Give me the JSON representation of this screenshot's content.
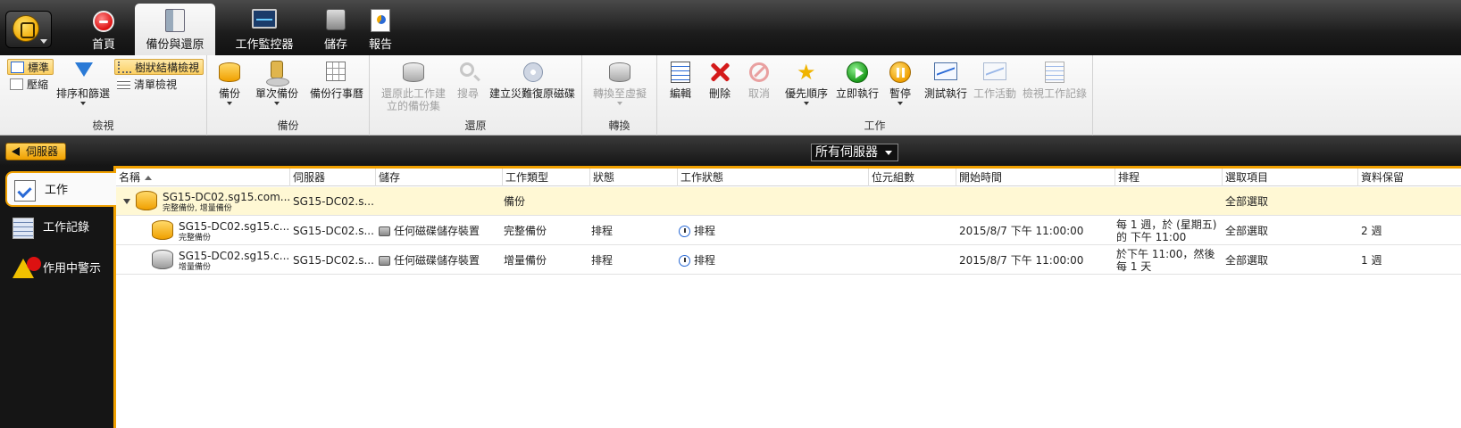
{
  "tabs": [
    {
      "label": "首頁",
      "icon": "home-icon"
    },
    {
      "label": "備份與還原",
      "icon": "backup-restore-icon",
      "active": true
    },
    {
      "label": "工作監控器",
      "icon": "monitor-icon"
    },
    {
      "label": "儲存",
      "icon": "storage-icon"
    },
    {
      "label": "報告",
      "icon": "report-icon"
    }
  ],
  "ribbon": {
    "view": {
      "label": "檢視",
      "standard": "標準",
      "compact": "壓縮",
      "sort_filter": "排序和篩選",
      "tree_view": "樹狀結構檢視",
      "list_view": "清單檢視"
    },
    "backup": {
      "label": "備份",
      "backup": "備份",
      "one_time": "單次備份",
      "calendar": "備份行事曆"
    },
    "restore": {
      "label": "還原",
      "restore_from_set": "還原此工作建立的備份集",
      "search": "搜尋",
      "create_dr_disk": "建立災難復原磁碟"
    },
    "convert": {
      "label": "轉換",
      "convert_to_virtual": "轉換至虛擬"
    },
    "jobs": {
      "label": "工作",
      "edit": "編輯",
      "delete": "刪除",
      "cancel": "取消",
      "priority": "優先順序",
      "run_now": "立即執行",
      "pause": "暫停",
      "test_run": "測試執行",
      "job_activity": "工作活動",
      "view_history": "檢視工作記錄"
    }
  },
  "navbar": {
    "back_label": "伺服器",
    "server_filter": "所有伺服器"
  },
  "leftnav": [
    {
      "label": "工作",
      "icon": "job-icon",
      "active": true
    },
    {
      "label": "工作記錄",
      "icon": "job-history-icon"
    },
    {
      "label": "作用中警示",
      "icon": "active-alerts-icon"
    }
  ],
  "columns": [
    "名稱",
    "伺服器",
    "儲存",
    "工作類型",
    "狀態",
    "工作狀態",
    "位元組數",
    "開始時間",
    "排程",
    "選取項目",
    "資料保留"
  ],
  "rows": [
    {
      "name": "SG15-DC02.sg15.com...",
      "subname": "完整備份, 增量備份",
      "server": "SG15-DC02.s...",
      "storage": "",
      "job_type": "備份",
      "status": "",
      "job_status": "",
      "bytes": "",
      "start_time": "",
      "schedule": "",
      "selection": "全部選取",
      "retention": ""
    },
    {
      "name": "SG15-DC02.sg15.c...",
      "subname": "完整備份",
      "server": "SG15-DC02.s...",
      "storage": "任何磁碟儲存裝置",
      "job_type": "完整備份",
      "status": "排程",
      "job_status": "排程",
      "bytes": "",
      "start_time": "2015/8/7 下午 11:00:00",
      "schedule_line1": "每 1 週，於 (星期五)",
      "schedule_line2": "的 下午 11:00",
      "selection": "全部選取",
      "retention": "2 週"
    },
    {
      "name": "SG15-DC02.sg15.c...",
      "subname": "增量備份",
      "server": "SG15-DC02.s...",
      "storage": "任何磁碟儲存裝置",
      "job_type": "增量備份",
      "status": "排程",
      "job_status": "排程",
      "bytes": "",
      "start_time": "2015/8/7 下午 11:00:00",
      "schedule_line1": "於下午 11:00，然後",
      "schedule_line2": "每 1 天",
      "selection": "全部選取",
      "retention": "1 週"
    }
  ]
}
